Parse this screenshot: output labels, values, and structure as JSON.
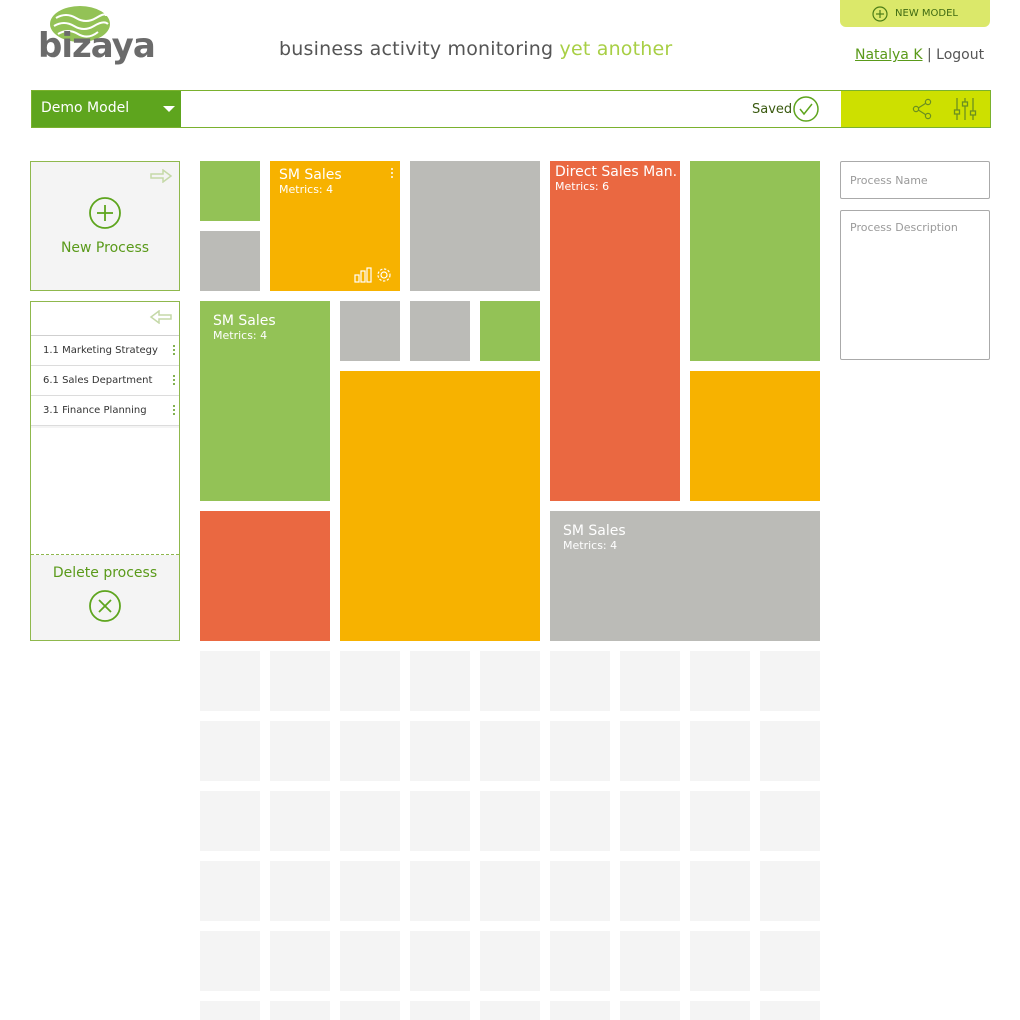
{
  "brand": {
    "logo_text": "bizaya"
  },
  "tagline": {
    "main": "business activity monitoring",
    "accent": "yet another"
  },
  "header": {
    "new_model_label": "NEW MODEL",
    "user_name": "Natalya K",
    "separator": "|",
    "logout_label": "Logout"
  },
  "toolbar": {
    "model_name": "Demo Model",
    "status": "Saved",
    "icons": [
      "share-icon",
      "settings-sliders-icon"
    ]
  },
  "left_panel": {
    "new_process_label": "New Process",
    "processes": [
      {
        "label": "1.1 Marketing Strategy"
      },
      {
        "label": "6.1 Sales Department"
      },
      {
        "label": "3.1 Finance Planning"
      }
    ],
    "delete_label": "Delete process"
  },
  "tiles": {
    "tile1": {
      "title": "SM Sales",
      "metrics": "Metrics: 4"
    },
    "tile2": {
      "title": "Direct Sales Man...",
      "metrics": "Metrics: 6"
    },
    "tile3": {
      "title": "SM Sales",
      "metrics": "Metrics: 4"
    },
    "tile4": {
      "title": "SM Sales",
      "metrics": "Metrics: 4"
    }
  },
  "form": {
    "name_placeholder": "Process Name",
    "description_placeholder": "Process Description"
  },
  "colors": {
    "brand_green": "#5ea51e",
    "lime": "#cde000",
    "tile_green": "#93c256",
    "tile_grey": "#bbbbb7",
    "tile_orange": "#f7b200",
    "tile_red": "#ea6841"
  }
}
